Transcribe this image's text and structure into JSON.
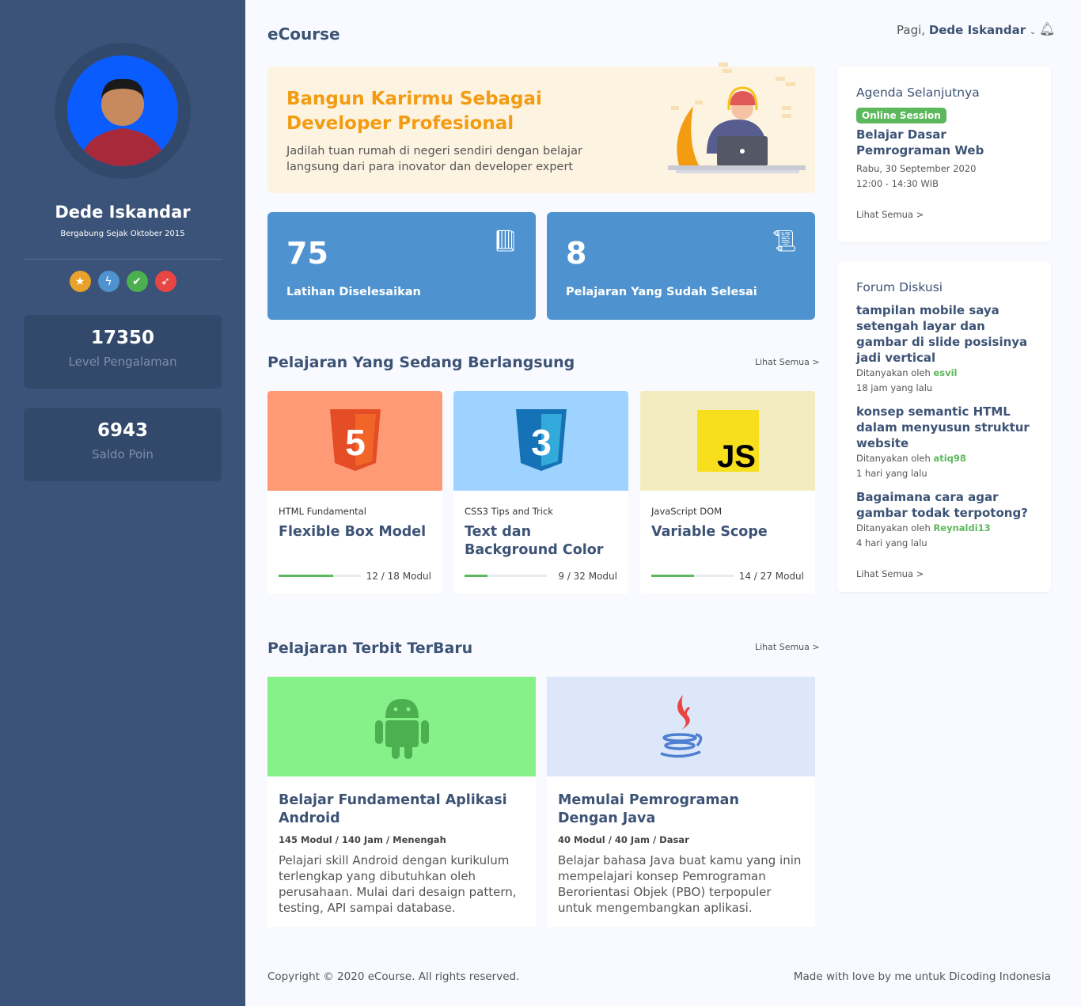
{
  "sidebar": {
    "name": "Dede Iskandar",
    "joined": "Bergabung Sejak Oktober 2015",
    "badges": [
      "star-badge",
      "lightning-badge",
      "shield-badge",
      "rocket-badge"
    ],
    "stats": [
      {
        "value": "17350",
        "label": "Level Pengalaman"
      },
      {
        "value": "6943",
        "label": "Saldo Poin"
      }
    ]
  },
  "header": {
    "logo": "eCourse",
    "greeting": "Pagi,",
    "user": "Dede Iskandar"
  },
  "banner": {
    "title": "Bangun Karirmu Sebagai Developer Profesional",
    "text": "Jadilah tuan rumah di negeri sendiri dengan belajar langsung dari para inovator dan developer expert"
  },
  "summary": [
    {
      "value": "75",
      "label": "Latihan Diselesaikan",
      "icon": "book-icon"
    },
    {
      "value": "8",
      "label": "Pelajaran Yang Sudah Selesai",
      "icon": "certificate-icon"
    }
  ],
  "ongoing": {
    "title": "Pelajaran Yang Sedang Berlangsung",
    "see_all": "Lihat Semua >",
    "courses": [
      {
        "category": "HTML Fundamental",
        "title": "Flexible Box Model",
        "progress_text": "12 / 18 Modul",
        "progress": 0.667,
        "color": "#ff9a76"
      },
      {
        "category": "CSS3 Tips and Trick",
        "title": "Text dan Background Color",
        "progress_text": "9 / 32 Modul",
        "progress": 0.281,
        "color": "#9fd3ff"
      },
      {
        "category": "JavaScript DOM",
        "title": "Variable Scope",
        "progress_text": "14 / 27 Modul",
        "progress": 0.519,
        "color": "#f3ecc0"
      }
    ]
  },
  "newest": {
    "title": "Pelajaran Terbit TerBaru",
    "see_all": "Lihat Semua >",
    "courses": [
      {
        "title": "Belajar Fundamental Aplikasi Android",
        "meta": "145 Modul / 140 Jam / Menengah",
        "desc": "Pelajari skill Android dengan kurikulum terlengkap yang dibutuhkan oleh perusahaan. Mulai dari desaign pattern, testing, API sampai database."
      },
      {
        "title": "Memulai Pemrograman Dengan Java",
        "meta": "40 Modul / 40 Jam / Dasar",
        "desc": "Belajar bahasa Java buat kamu yang inin mempelajari konsep Pemrograman Berorientasi Objek (PBO) terpopuler untuk mengembangkan aplikasi."
      }
    ]
  },
  "agenda": {
    "title": "Agenda Selanjutnya",
    "tag": "Online Session",
    "event": "Belajar Dasar Pemrograman Web",
    "date": "Rabu, 30 September 2020",
    "time": "12:00 - 14:30 WIB",
    "see_all": "Lihat Semua >"
  },
  "forum": {
    "title": "Forum Diskusi",
    "asked_by": "Ditanyakan oleh",
    "see_all": "Lihat Semua >",
    "items": [
      {
        "q": "tampilan mobile saya setengah layar dan gambar di slide posisinya jadi vertical",
        "user": "esvil",
        "time": "18 jam yang lalu"
      },
      {
        "q": "konsep semantic HTML dalam menyusun struktur website",
        "user": "atiq98",
        "time": "1 hari yang lalu"
      },
      {
        "q": "Bagaimana cara agar gambar todak terpotong?",
        "user": "Reynaldi13",
        "time": "4 hari yang lalu"
      }
    ]
  },
  "footer": {
    "copyright": "Copyright © 2020 eCourse. All rights reserved.",
    "credit": "Made with love by me untuk Dicoding Indonesia"
  }
}
